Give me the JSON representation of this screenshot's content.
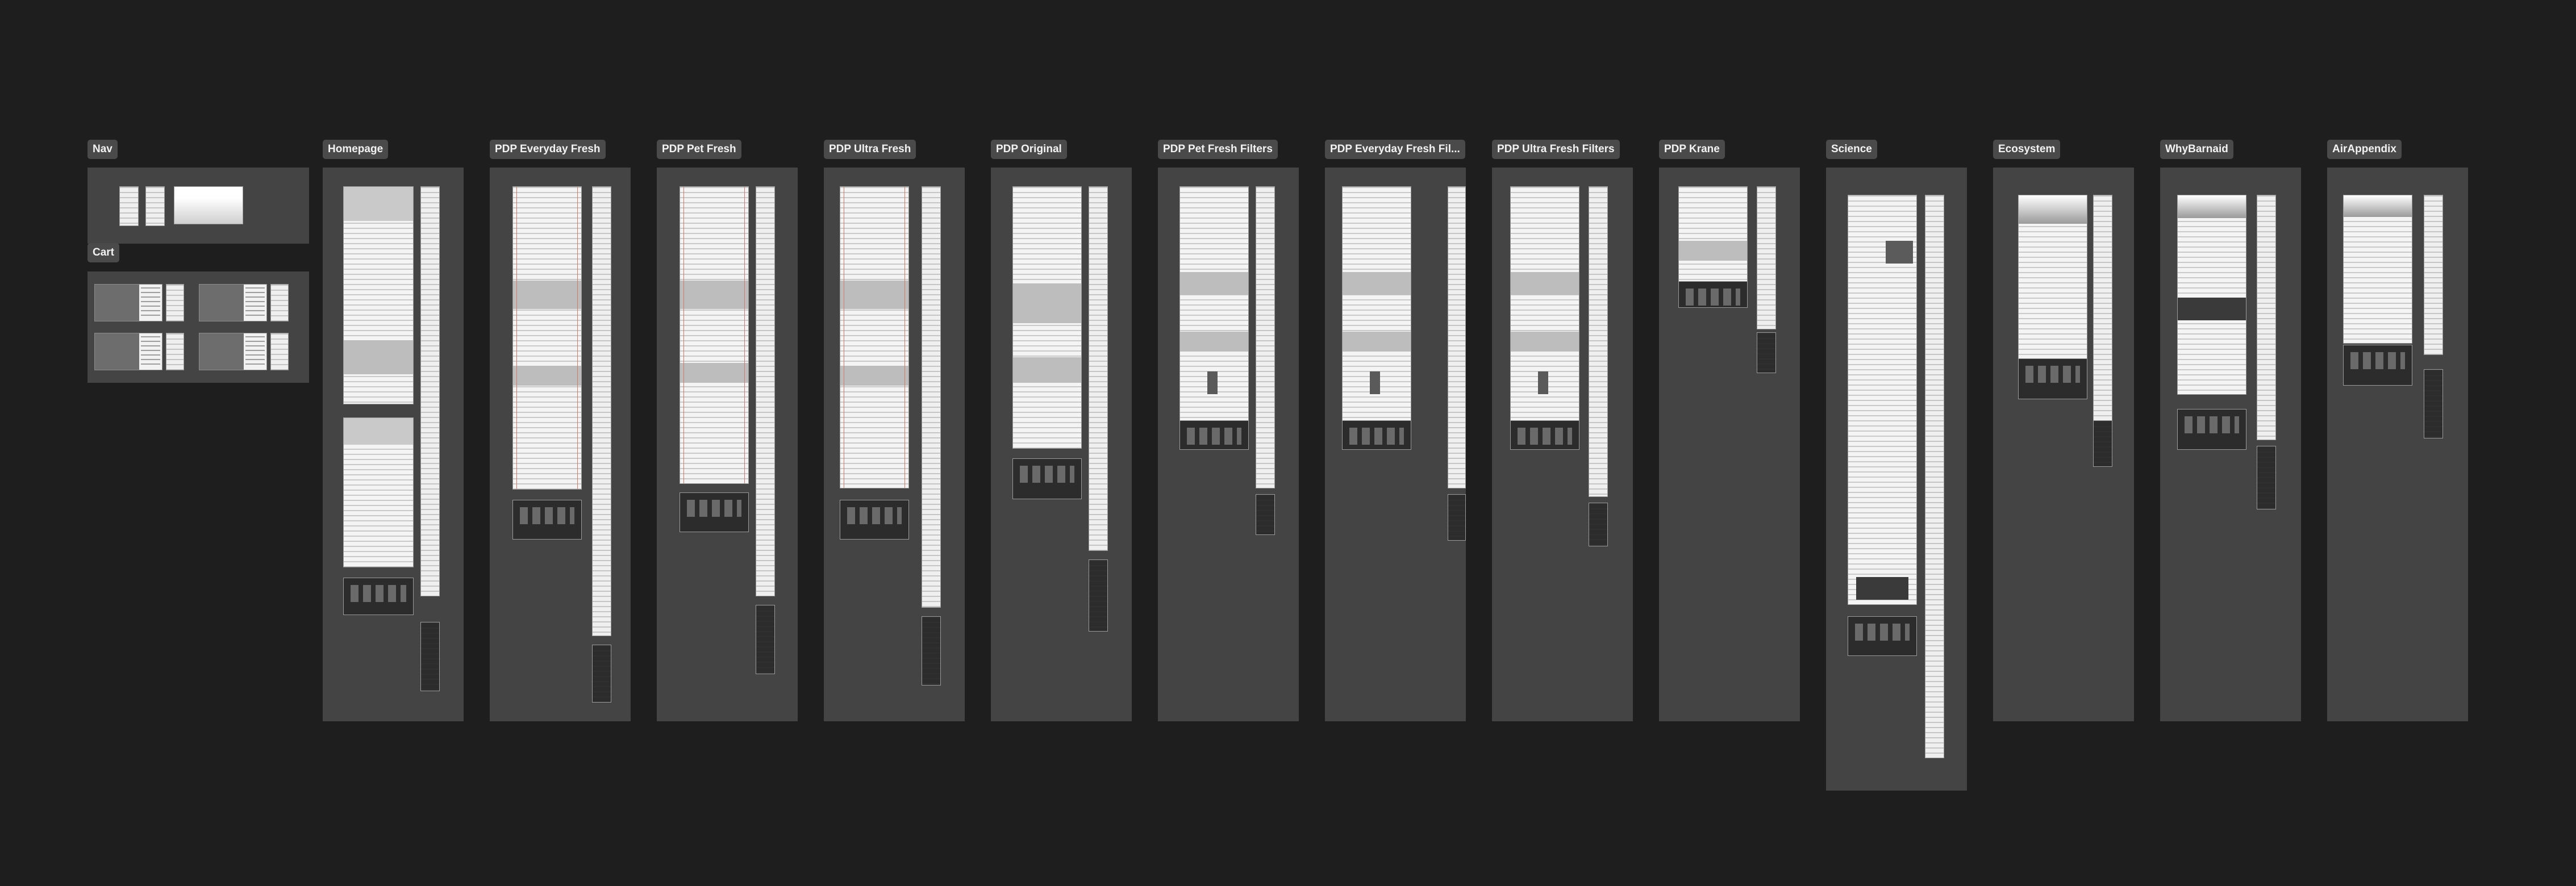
{
  "canvas": {
    "background": "#1e1e1e",
    "section_fill": "#444444",
    "label_fill": "#4a4a4a"
  },
  "sections": [
    {
      "id": "nav",
      "label": "Nav"
    },
    {
      "id": "cart",
      "label": "Cart"
    },
    {
      "id": "homepage",
      "label": "Homepage"
    },
    {
      "id": "pdp-everyday-fresh",
      "label": "PDP Everyday Fresh"
    },
    {
      "id": "pdp-pet-fresh",
      "label": "PDP Pet Fresh"
    },
    {
      "id": "pdp-ultra-fresh",
      "label": "PDP Ultra Fresh"
    },
    {
      "id": "pdp-original",
      "label": "PDP Original"
    },
    {
      "id": "pdp-pet-fresh-filters",
      "label": "PDP Pet Fresh Filters"
    },
    {
      "id": "pdp-everyday-fresh-filters",
      "label": "PDP Everyday Fresh Fil..."
    },
    {
      "id": "pdp-ultra-fresh-filters",
      "label": "PDP Ultra Fresh Filters"
    },
    {
      "id": "pdp-krane",
      "label": "PDP Krane"
    },
    {
      "id": "science",
      "label": "Science"
    },
    {
      "id": "ecosystem",
      "label": "Ecosystem"
    },
    {
      "id": "whybarnaid",
      "label": "WhyBarnaid"
    },
    {
      "id": "airappendix",
      "label": "AirAppendix"
    }
  ]
}
